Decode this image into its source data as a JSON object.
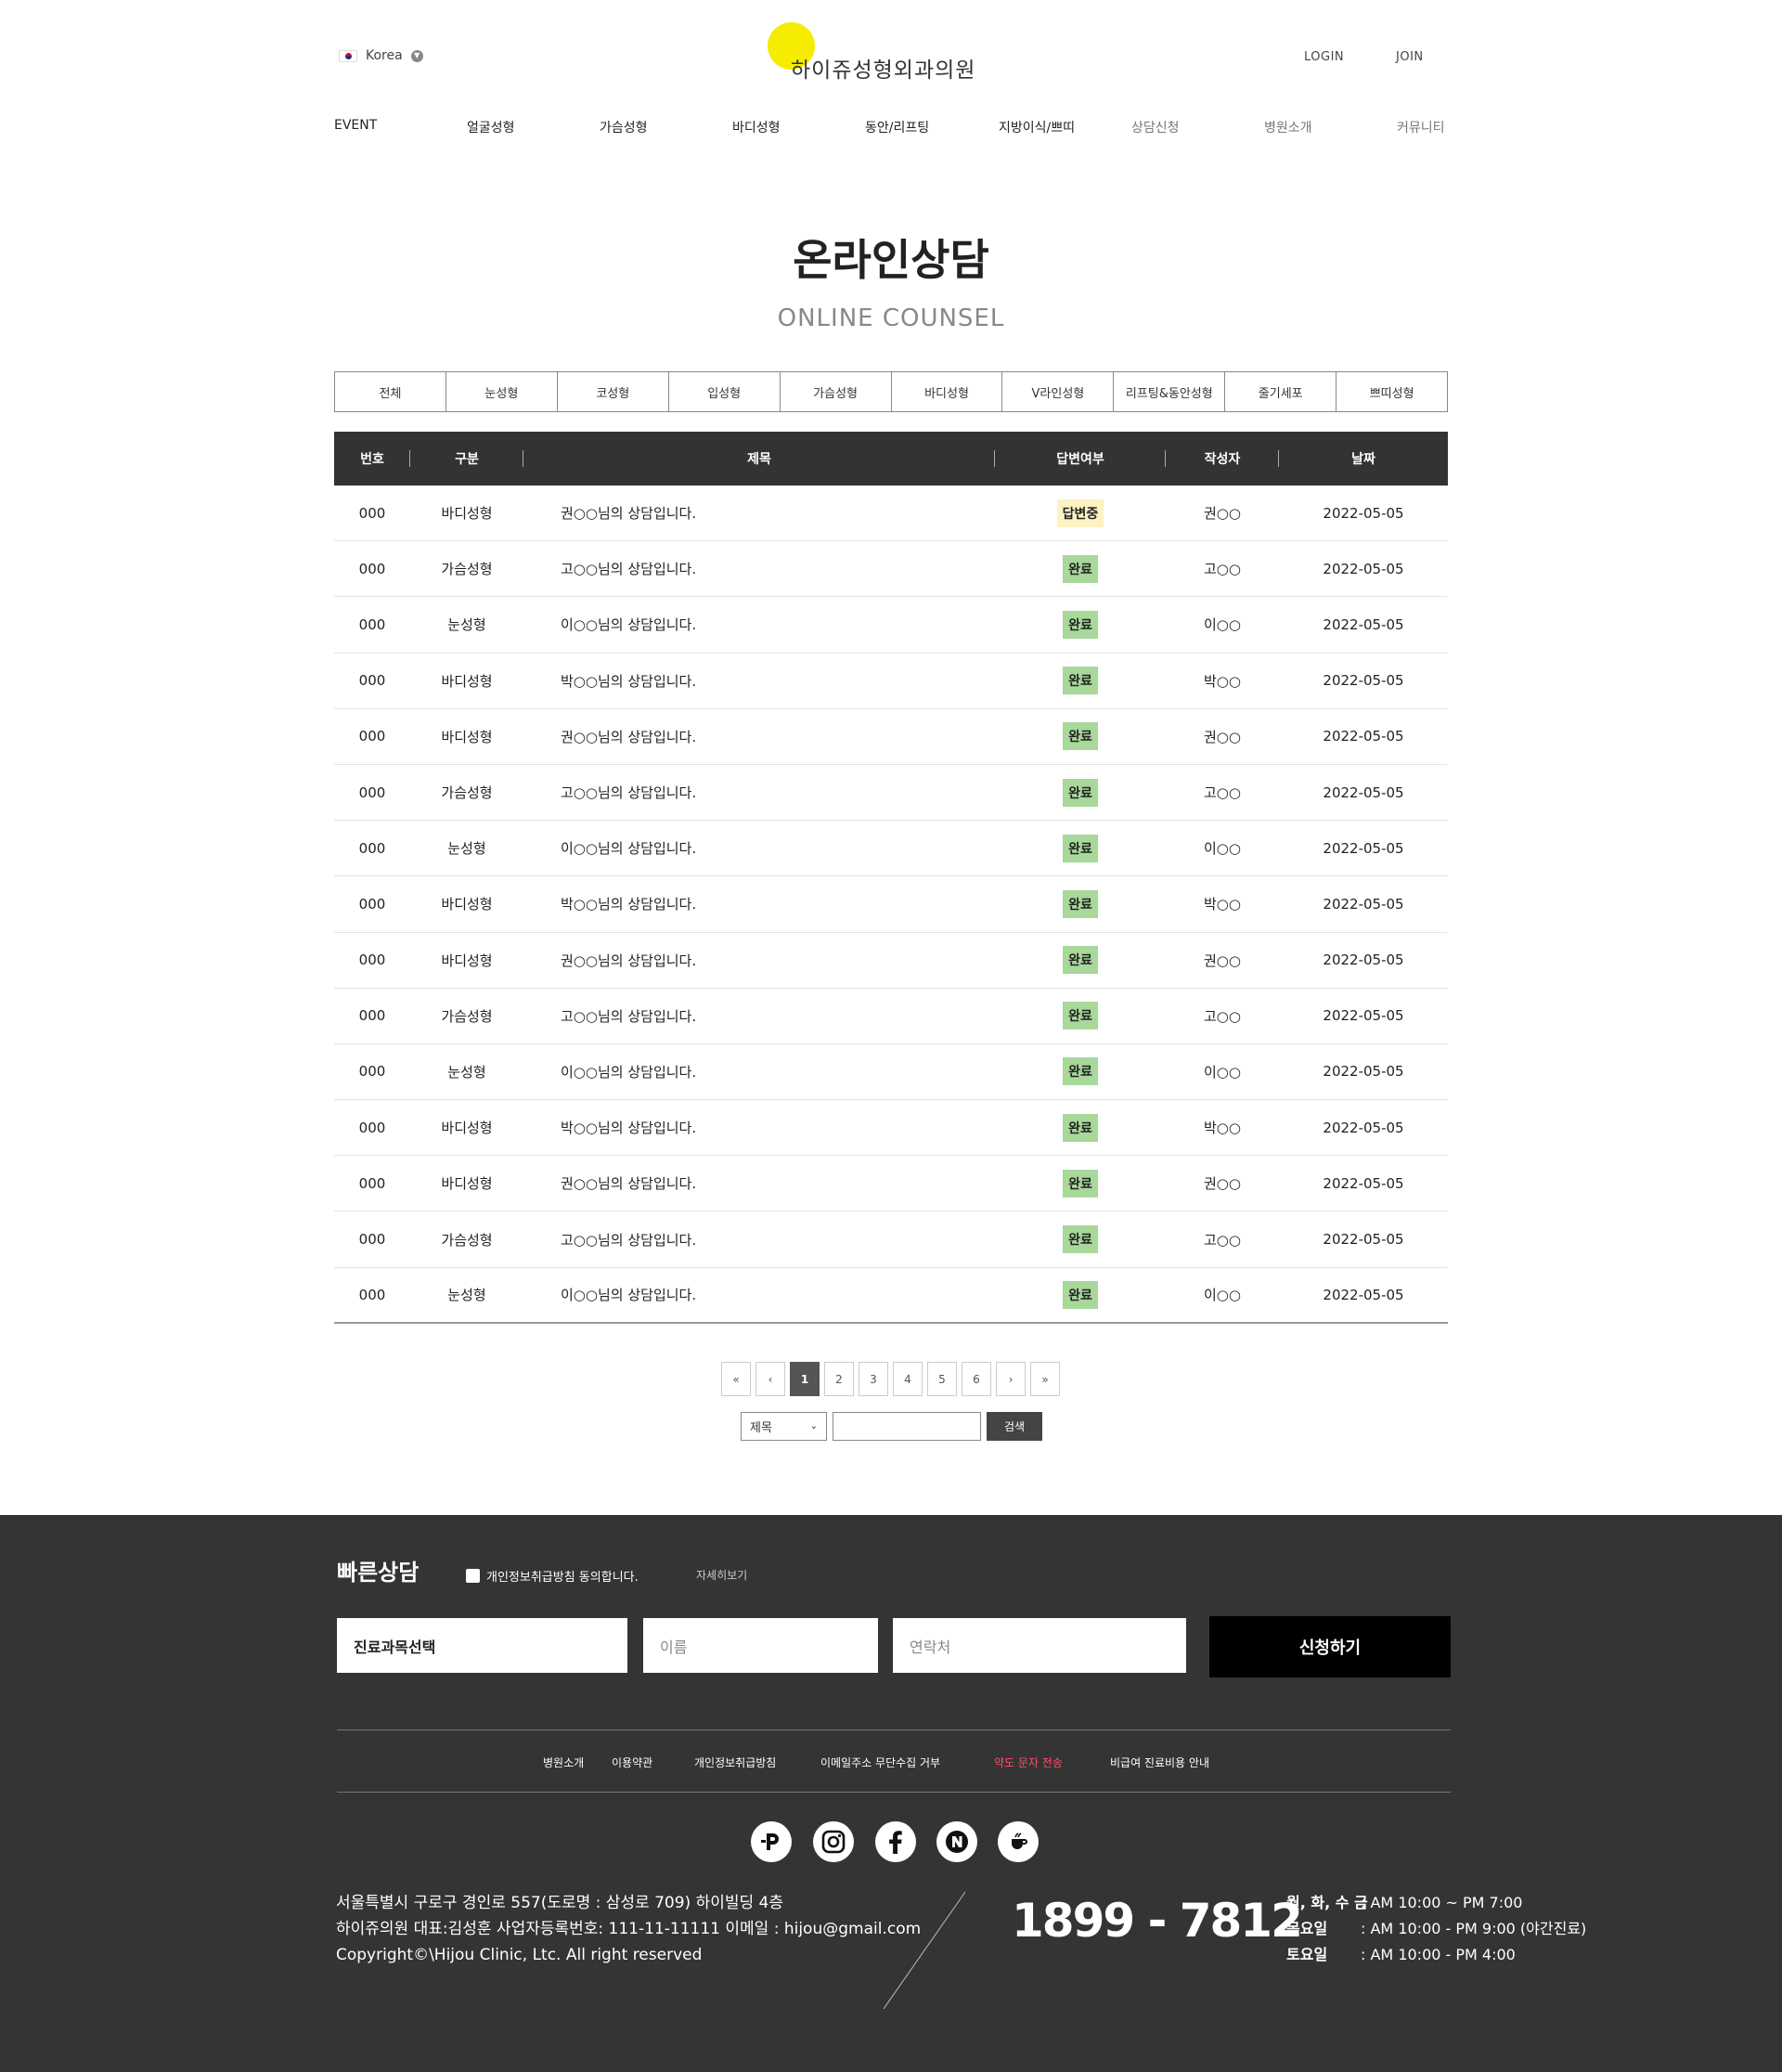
{
  "header": {
    "language": "Korea",
    "logo": "하이쥬성형외과의원",
    "login": "LOGIN",
    "join": "JOIN",
    "nav": [
      "EVENT",
      "얼굴성형",
      "가슴성형",
      "바디성형",
      "동안/리프팅",
      "지방이식/쁘띠",
      "상담신청",
      "병원소개",
      "커뮤니티"
    ]
  },
  "page": {
    "title": "온라인상담",
    "subtitle": "ONLINE COUNSEL"
  },
  "categories": [
    "전체",
    "눈성형",
    "코성형",
    "입성형",
    "가슴성형",
    "바디성형",
    "V라인성형",
    "리프팅&동안성형",
    "줄기세포",
    "쁘띠성형"
  ],
  "table": {
    "headers": {
      "no": "번호",
      "category": "구분",
      "title": "제목",
      "answer": "답변여부",
      "writer": "작성자",
      "date": "날짜"
    },
    "rows": [
      {
        "no": "000",
        "category": "바디성형",
        "title": "권○○님의 상담입니다.",
        "answer": "답변중",
        "writer": "권○○",
        "date": "2022-05-05"
      },
      {
        "no": "000",
        "category": "가슴성형",
        "title": "고○○님의 상담입니다.",
        "answer": "완료",
        "writer": "고○○",
        "date": "2022-05-05"
      },
      {
        "no": "000",
        "category": "눈성형",
        "title": "이○○님의 상담입니다.",
        "answer": "완료",
        "writer": "이○○",
        "date": "2022-05-05"
      },
      {
        "no": "000",
        "category": "바디성형",
        "title": "박○○님의 상담입니다.",
        "answer": "완료",
        "writer": "박○○",
        "date": "2022-05-05"
      },
      {
        "no": "000",
        "category": "바디성형",
        "title": "권○○님의 상담입니다.",
        "answer": "완료",
        "writer": "권○○",
        "date": "2022-05-05"
      },
      {
        "no": "000",
        "category": "가슴성형",
        "title": "고○○님의 상담입니다.",
        "answer": "완료",
        "writer": "고○○",
        "date": "2022-05-05"
      },
      {
        "no": "000",
        "category": "눈성형",
        "title": "이○○님의 상담입니다.",
        "answer": "완료",
        "writer": "이○○",
        "date": "2022-05-05"
      },
      {
        "no": "000",
        "category": "바디성형",
        "title": "박○○님의 상담입니다.",
        "answer": "완료",
        "writer": "박○○",
        "date": "2022-05-05"
      },
      {
        "no": "000",
        "category": "바디성형",
        "title": "권○○님의 상담입니다.",
        "answer": "완료",
        "writer": "권○○",
        "date": "2022-05-05"
      },
      {
        "no": "000",
        "category": "가슴성형",
        "title": "고○○님의 상담입니다.",
        "answer": "완료",
        "writer": "고○○",
        "date": "2022-05-05"
      },
      {
        "no": "000",
        "category": "눈성형",
        "title": "이○○님의 상담입니다.",
        "answer": "완료",
        "writer": "이○○",
        "date": "2022-05-05"
      },
      {
        "no": "000",
        "category": "바디성형",
        "title": "박○○님의 상담입니다.",
        "answer": "완료",
        "writer": "박○○",
        "date": "2022-05-05"
      },
      {
        "no": "000",
        "category": "바디성형",
        "title": "권○○님의 상담입니다.",
        "answer": "완료",
        "writer": "권○○",
        "date": "2022-05-05"
      },
      {
        "no": "000",
        "category": "가슴성형",
        "title": "고○○님의 상담입니다.",
        "answer": "완료",
        "writer": "고○○",
        "date": "2022-05-05"
      },
      {
        "no": "000",
        "category": "눈성형",
        "title": "이○○님의 상담입니다.",
        "answer": "완료",
        "writer": "이○○",
        "date": "2022-05-05"
      }
    ]
  },
  "pagination": {
    "first": "«",
    "prev": "‹",
    "pages": [
      "1",
      "2",
      "3",
      "4",
      "5",
      "6"
    ],
    "current": "1",
    "next": "›",
    "last": "»"
  },
  "search": {
    "field": "제목",
    "button": "검색"
  },
  "footer": {
    "quick_title": "빠른상담",
    "agree_label": "개인정보취급방침 동의합니다.",
    "more_link": "자세히보기",
    "field_subject": "진료과목선택",
    "field_name_placeholder": "이름",
    "field_phone_placeholder": "연락처",
    "submit": "신청하기",
    "links": [
      "병원소개",
      "이용약관",
      "개인정보취급방침",
      "이메일주소 무단수집 거부",
      "약도 문자 전송",
      "비급여 진료비용 안내"
    ],
    "sns": [
      "naver-pay-icon",
      "instagram-icon",
      "facebook-icon",
      "naver-blog-icon",
      "kakao-story-icon"
    ],
    "address": "서울특별시 구로구 경인로 557(도로명 : 삼성로 709) 하이빌딩 4층",
    "business": "하이쥬의원 대표:김성훈 사업자등록번호: 111-11-11111 이메일 : hijou@gmail.com",
    "copyright": "Copyright©\\Hijou Clinic, Ltc. All right reserved",
    "phone": "1899 - 7812",
    "hours": [
      {
        "day": "월, 화, 수 금",
        "time": ": AM 10:00 ~ PM 7:00"
      },
      {
        "day": "목요일",
        "time": ": AM 10:00 - PM 9:00 (야간진료)"
      },
      {
        "day": "토요일",
        "time": ": AM 10:00 - PM 4:00"
      }
    ]
  },
  "colors": {
    "accent_yellow": "#f6ec00",
    "status_done": "#a8d89a",
    "status_pending": "#fdf3c2",
    "header_bg": "#333333",
    "footer_bg": "#343434",
    "link_red": "#ff4d6d"
  }
}
